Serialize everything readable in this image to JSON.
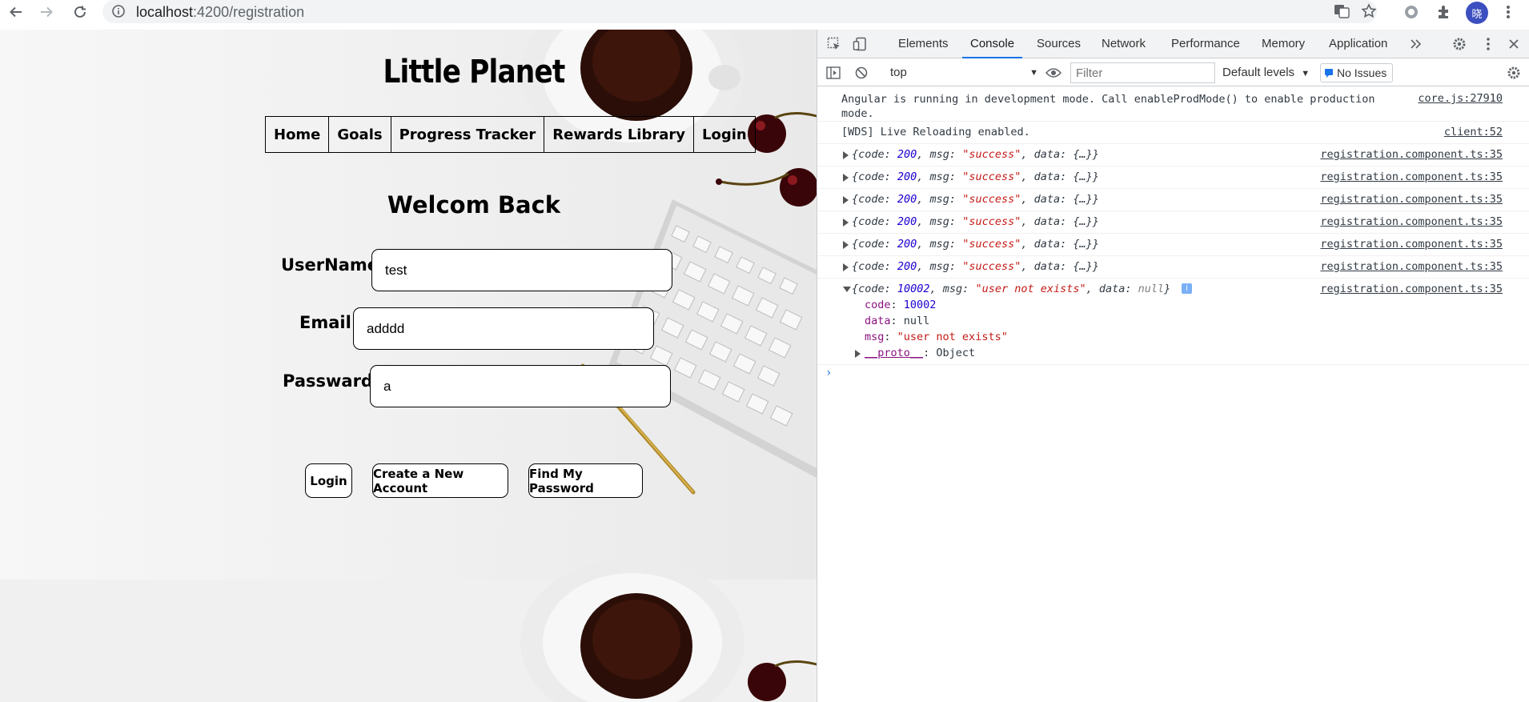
{
  "browser": {
    "url_host": "localhost",
    "url_path": ":4200/registration",
    "avatar_letter": "晓",
    "accent": "#1a73e8"
  },
  "page": {
    "title": "Little Planet",
    "nav": [
      "Home",
      "Goals",
      "Progress Tracker",
      "Rewards Library",
      "Login"
    ],
    "welcome": "Welcom Back",
    "form": {
      "username_label": "UserName:",
      "username_value": "test",
      "email_label": "Email:",
      "email_value": "adddd",
      "password_label": "Passward:",
      "password_value": "a"
    },
    "buttons": {
      "login": "Login",
      "create": "Create a New Account",
      "find": "Find My Password"
    }
  },
  "devtools": {
    "tabs": [
      "Elements",
      "Console",
      "Sources",
      "Network",
      "Performance",
      "Memory",
      "Application"
    ],
    "active_tab": "Console",
    "context": "top",
    "filter_placeholder": "Filter",
    "levels": "Default levels",
    "issues": "No Issues",
    "console": {
      "angular_msg": "Angular is running in development mode. Call enableProdMode() to enable production",
      "angular_msg_cont": "mode.",
      "angular_src": "core.js:27910",
      "wds_msg": "[WDS] Live Reloading enabled.",
      "wds_src": "client:52",
      "success_src": "registration.component.ts:35",
      "success_code": "200",
      "success_msg": "\"success\"",
      "success_rows": 6,
      "error_code": "10002",
      "error_msg": "\"user not exists\"",
      "error_data": "null",
      "error_src": "registration.component.ts:35",
      "expanded": {
        "code_key": "code",
        "code_val": "10002",
        "data_key": "data",
        "data_val": "null",
        "msg_key": "msg",
        "msg_val": "\"user not exists\"",
        "proto_key": "__proto__",
        "proto_val": "Object"
      }
    }
  }
}
